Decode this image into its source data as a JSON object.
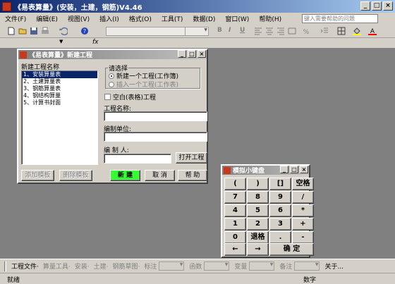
{
  "app": {
    "title": "《易表算量》(安装，土建，钢筋)V4.46"
  },
  "menu": {
    "items": [
      "文件(F)",
      "编辑(E)",
      "视图(V)",
      "插入(I)",
      "格式(O)",
      "工具(T)",
      "数据(D)",
      "窗口(W)",
      "帮助(H)"
    ],
    "help_placeholder": "键入需要帮助的问题"
  },
  "toolbar": {
    "bold": "B",
    "italic": "I",
    "underline": "U"
  },
  "formula": {
    "fx": "fx"
  },
  "dialog": {
    "title": "《易表算量》新建工程",
    "list_label": "新建工程名称",
    "projects": [
      "1、安装算量表",
      "2、土建算量表",
      "3、钢筋算量表",
      "4、钢结构算量",
      "5、计算书封面"
    ],
    "selected_index": 0,
    "choose_label": "请选择",
    "option_new": "新建一个工程(工作簿)",
    "option_insert": "插入一个工程(工作表)",
    "blank_label": "空白(表格)工程",
    "name_label": "工程名称:",
    "unit_label": "编制单位:",
    "author_label": "编 制 人:",
    "open_button": "打开工程",
    "add_template": "添加模板",
    "delete_template": "删除模板",
    "create_button": "新 建",
    "cancel_button": "取 消",
    "help_button": "帮 助",
    "new_color": "#33ff33"
  },
  "keypad": {
    "title": "模拟小键盘",
    "rows": [
      [
        "(",
        ")",
        "[]",
        "空格"
      ],
      [
        "7",
        "8",
        "9",
        "/"
      ],
      [
        "4",
        "5",
        "6",
        "*"
      ],
      [
        "1",
        "2",
        "3",
        "+"
      ],
      [
        "0",
        "退格",
        ".",
        "-"
      ]
    ],
    "left": "←",
    "right": "→",
    "enter": "确 定"
  },
  "bottom": {
    "items": [
      {
        "label": "工程文件·",
        "disabled": false
      },
      {
        "label": "算量工具·",
        "disabled": true
      },
      {
        "label": "安装·",
        "disabled": true
      },
      {
        "label": "土建·",
        "disabled": true
      },
      {
        "label": "钢筋草图·",
        "disabled": true
      },
      {
        "label": "标注",
        "disabled": true,
        "combo": true
      },
      {
        "label": "函数",
        "disabled": true,
        "combo": true
      },
      {
        "label": "变量",
        "disabled": true,
        "combo": true
      },
      {
        "label": "备注",
        "disabled": true,
        "combo": true
      },
      {
        "label": "关于...",
        "disabled": false,
        "combo": true
      }
    ]
  },
  "status": {
    "left": "就绪",
    "right": "数字"
  }
}
